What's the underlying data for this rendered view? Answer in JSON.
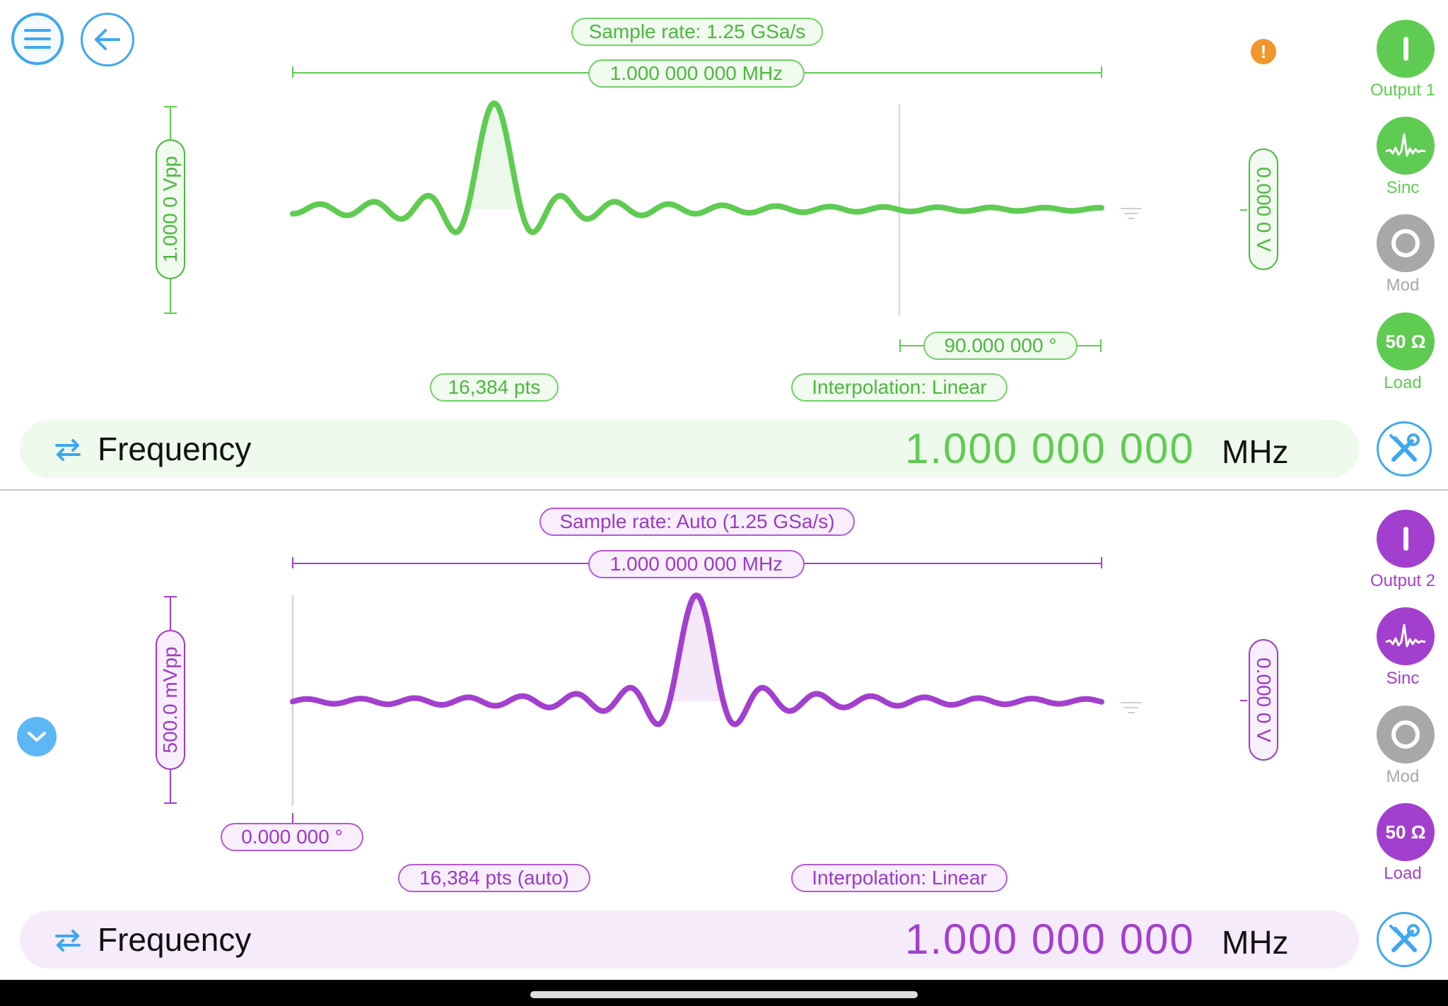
{
  "channels": [
    {
      "sample_rate": "Sample rate: 1.25 GSa/s",
      "span": "1.000 000 000 MHz",
      "amplitude": "1.000 0 Vpp",
      "offset": "0.000 0 V",
      "phase": "90.000 000 °",
      "points": "16,384 pts",
      "interpolation": "Interpolation: Linear",
      "freq_label": "Frequency",
      "freq_value": "1.000 000 000",
      "freq_unit": "MHz",
      "output_label": "Output 1",
      "waveform_label": "Sinc",
      "mod_label": "Mod",
      "load_value": "50 Ω",
      "load_label": "Load",
      "color": "#5fcb52"
    },
    {
      "sample_rate": "Sample rate: Auto (1.25 GSa/s)",
      "span": "1.000 000 000 MHz",
      "amplitude": "500.0 mVpp",
      "offset": "0.000 0 V",
      "phase": "0.000 000 °",
      "points": "16,384 pts (auto)",
      "interpolation": "Interpolation: Linear",
      "freq_label": "Frequency",
      "freq_value": "1.000 000 000",
      "freq_unit": "MHz",
      "output_label": "Output 2",
      "waveform_label": "Sinc",
      "mod_label": "Mod",
      "load_value": "50 Ω",
      "load_label": "Load",
      "color": "#a33fcf"
    }
  ],
  "colors": {
    "accent_blue": "#3ea8ef",
    "warning": "#f0962a",
    "mod_gray": "#a8a8a8"
  },
  "icons": [
    "menu-icon",
    "back-arrow-icon",
    "warning-icon",
    "collapse-chevron-icon",
    "swap-icon",
    "tools-icon",
    "sinc-wave-icon",
    "mod-icon"
  ]
}
